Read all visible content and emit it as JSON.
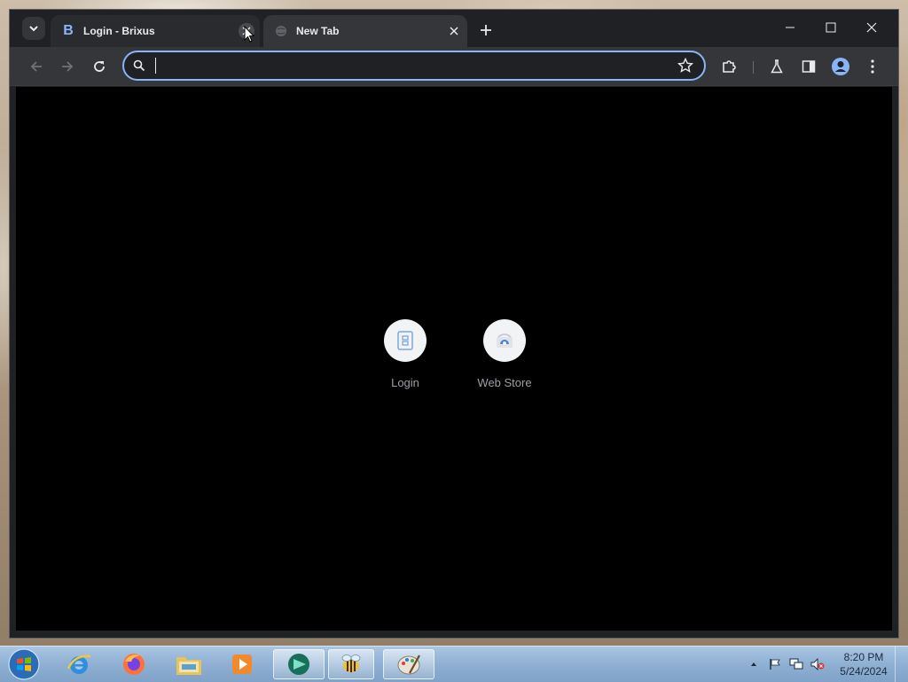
{
  "browser": {
    "tabs": [
      {
        "title": "Login - Brixus",
        "favicon": "B"
      },
      {
        "title": "New Tab"
      }
    ],
    "omnibox": {
      "value": "",
      "placeholder": ""
    }
  },
  "new_tab": {
    "shortcuts": [
      {
        "label": "Login"
      },
      {
        "label": "Web Store"
      }
    ]
  },
  "taskbar": {
    "clock_time": "8:20 PM",
    "clock_date": "5/24/2024"
  },
  "colors": {
    "accent": "#8ab4f8",
    "window_bg": "#202124",
    "toolbar_bg": "#35363a",
    "content_bg": "#000000"
  }
}
